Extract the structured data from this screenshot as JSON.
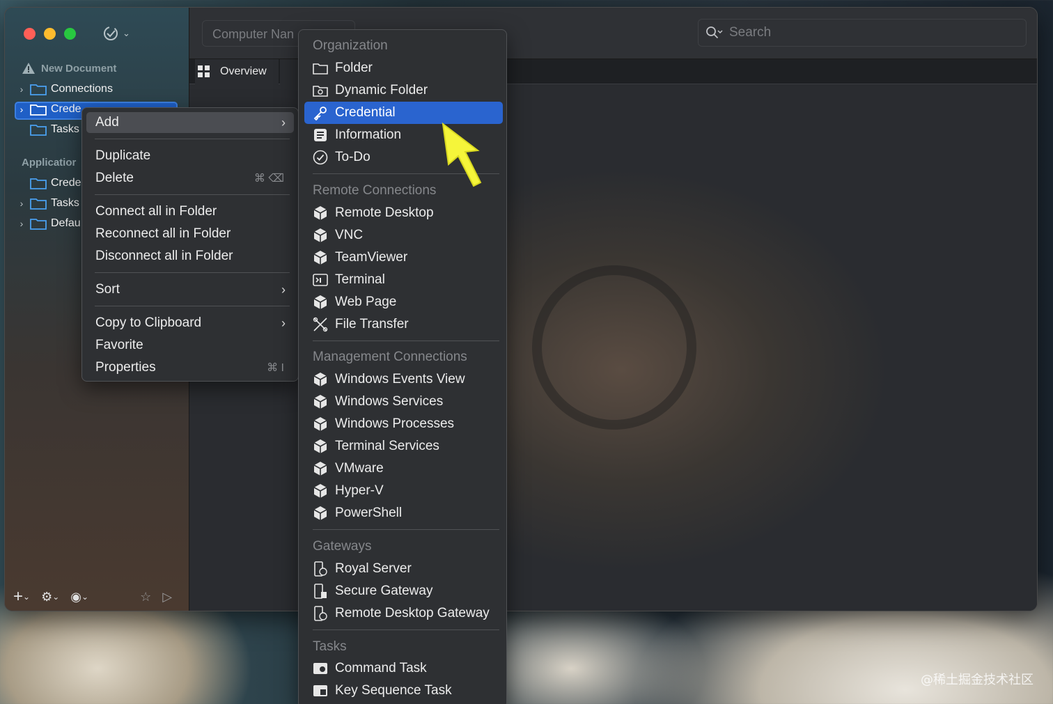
{
  "sidebar": {
    "doc_title": "New Document",
    "items": [
      {
        "label": "Connections"
      },
      {
        "label": "Crede"
      },
      {
        "label": "Tasks"
      }
    ],
    "app_header": "Applicatior",
    "app_items": [
      {
        "label": "Crede"
      },
      {
        "label": "Tasks"
      },
      {
        "label": "Defau"
      }
    ]
  },
  "toolbar": {
    "computer_name_placeholder": "Computer Nan",
    "search_placeholder": "Search"
  },
  "tabs": {
    "overview": "Overview"
  },
  "context_menu": {
    "add": "Add",
    "duplicate": "Duplicate",
    "delete": "Delete",
    "delete_shortcut": "⌘ ⌫",
    "connect_all": "Connect all in Folder",
    "reconnect_all": "Reconnect all in Folder",
    "disconnect_all": "Disconnect all in Folder",
    "sort": "Sort",
    "copy_clipboard": "Copy to Clipboard",
    "favorite": "Favorite",
    "properties": "Properties",
    "properties_shortcut": "⌘ I"
  },
  "submenu": {
    "organization": "Organization",
    "folder": "Folder",
    "dynamic_folder": "Dynamic Folder",
    "credential": "Credential",
    "information": "Information",
    "todo": "To-Do",
    "remote_connections": "Remote Connections",
    "remote_desktop": "Remote Desktop",
    "vnc": "VNC",
    "teamviewer": "TeamViewer",
    "terminal": "Terminal",
    "web_page": "Web Page",
    "file_transfer": "File Transfer",
    "management_connections": "Management Connections",
    "win_events": "Windows Events View",
    "win_services": "Windows Services",
    "win_processes": "Windows Processes",
    "terminal_services": "Terminal Services",
    "vmware": "VMware",
    "hyperv": "Hyper-V",
    "powershell": "PowerShell",
    "gateways": "Gateways",
    "royal_server": "Royal Server",
    "secure_gateway": "Secure Gateway",
    "rd_gateway": "Remote Desktop Gateway",
    "tasks": "Tasks",
    "command_task": "Command Task",
    "key_sequence_task": "Key Sequence Task"
  },
  "credit": "@稀土掘金技术社区",
  "colors": {
    "accent": "#2a64cf",
    "selection_border": "#3c7fe0",
    "cursor": "#f5f53a"
  }
}
